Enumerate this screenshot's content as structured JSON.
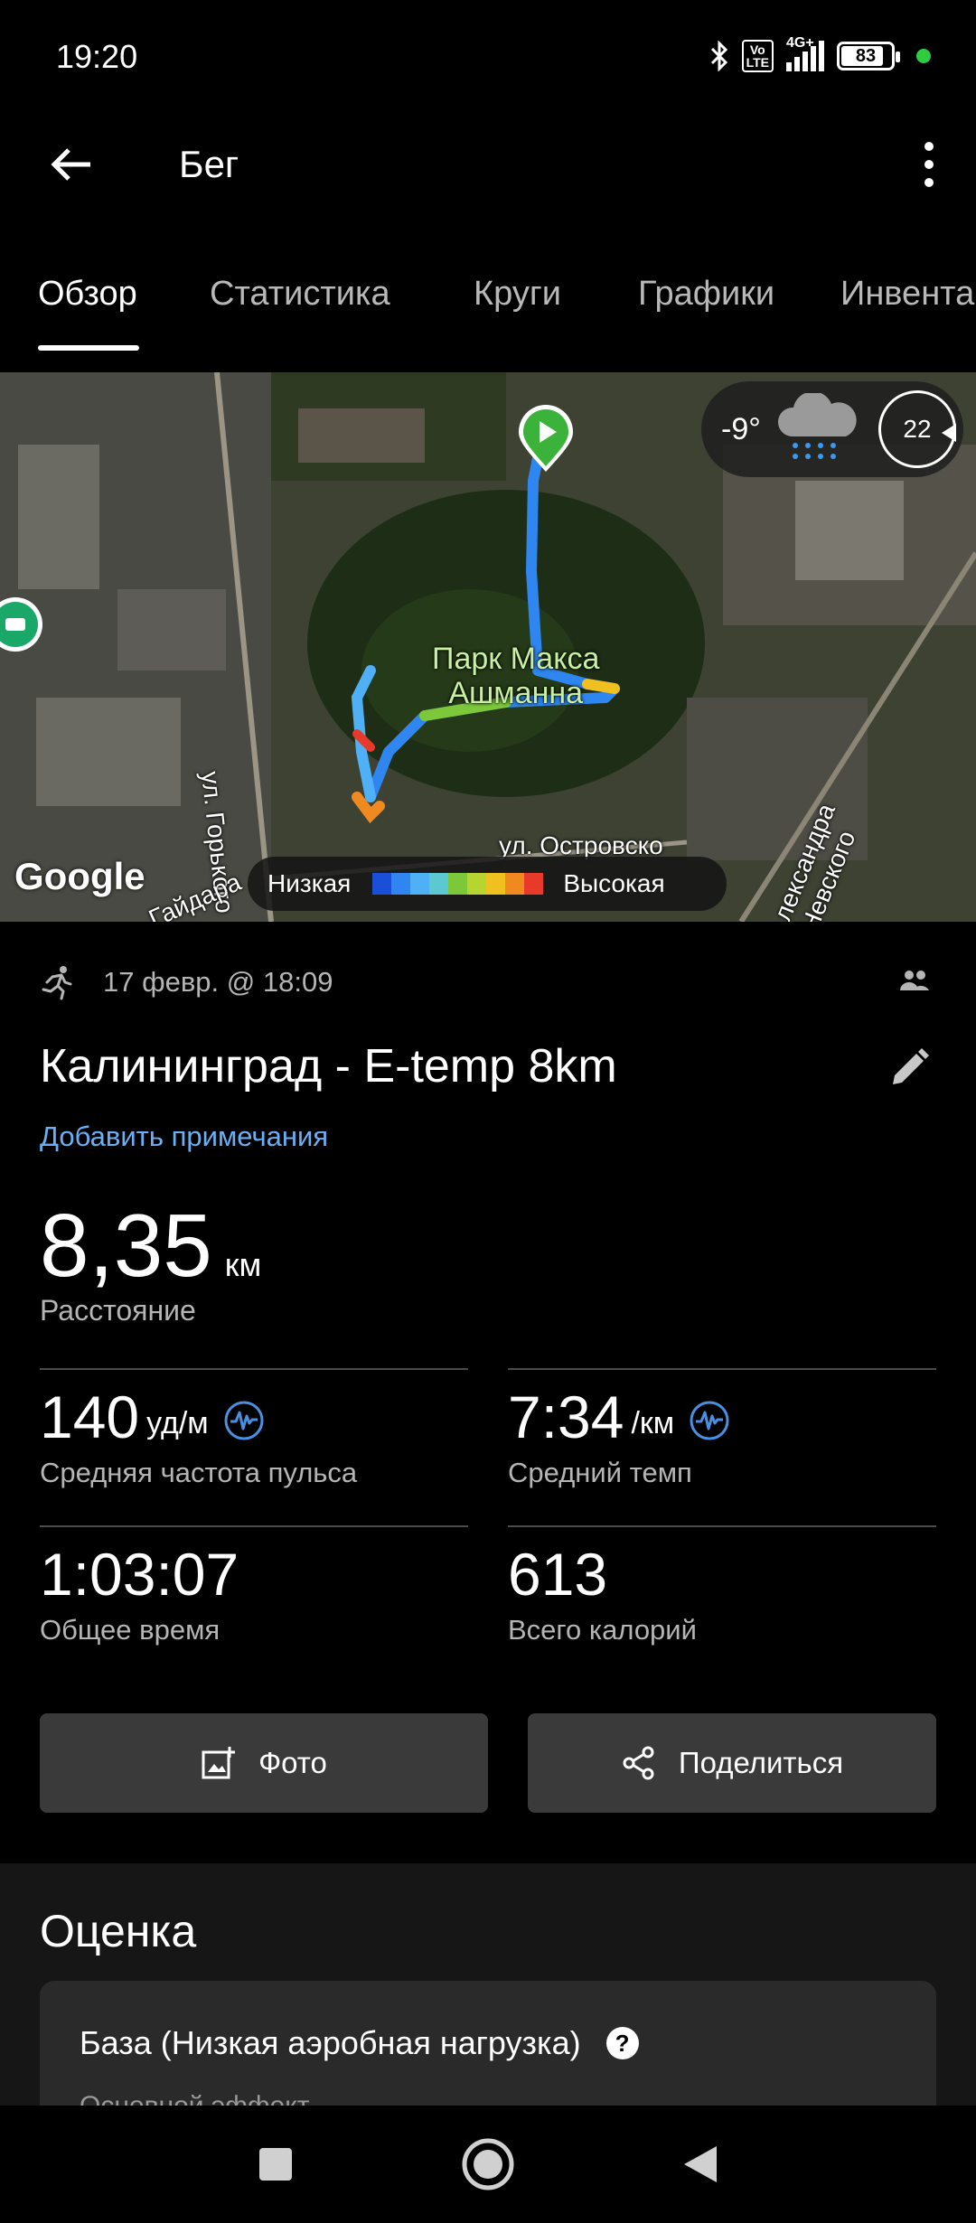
{
  "status": {
    "time": "19:20",
    "battery": "83",
    "network": "4G+",
    "volte": "Vo LTE"
  },
  "app_bar": {
    "title": "Бег"
  },
  "tabs": [
    {
      "label": "Обзор",
      "active": true
    },
    {
      "label": "Статистика"
    },
    {
      "label": "Круги"
    },
    {
      "label": "Графики"
    },
    {
      "label": "Инвента"
    }
  ],
  "map": {
    "weather_temp": "-9°",
    "wind_speed": "22",
    "park_label_line1": "Парк Макса",
    "park_label_line2": "Ашманна",
    "street_gorkogo": "ул. Горького",
    "street_ostrovskogo": "ул. Островско",
    "street_nevskogo": "лександра Невского",
    "street_gaidara": "Гайдара",
    "google": "Google",
    "legend_low": "Низкая",
    "legend_high": "Высокая",
    "legend_colors": [
      "#1a4fd8",
      "#2f86f0",
      "#4fb0f5",
      "#5cc8d0",
      "#7cc83a",
      "#b8d430",
      "#f0c020",
      "#f08a20",
      "#e83a2a"
    ]
  },
  "activity": {
    "date": "17 февр. @ 18:09",
    "title": "Калининград - E-temp 8km",
    "add_notes": "Добавить примечания",
    "distance_value": "8,35",
    "distance_unit": "км",
    "distance_label": "Расстояние",
    "stats": [
      {
        "value": "140",
        "unit": "уд/м",
        "label": "Средняя частота пульса"
      },
      {
        "value": "7:34",
        "unit": "/км",
        "label": "Средний темп"
      },
      {
        "value": "1:03:07",
        "unit": "",
        "label": "Общее время"
      },
      {
        "value": "613",
        "unit": "",
        "label": "Всего калорий"
      }
    ],
    "photo_button": "Фото",
    "share_button": "Поделиться"
  },
  "assessment": {
    "title": "Оценка",
    "card_title": "База (Низкая аэробная нагрузка)",
    "card_sub": "Основной эффект"
  },
  "colors": {
    "accent": "#6ab0f5",
    "background": "#000000",
    "card": "#2a2a2a",
    "button": "#3a3a3a"
  }
}
